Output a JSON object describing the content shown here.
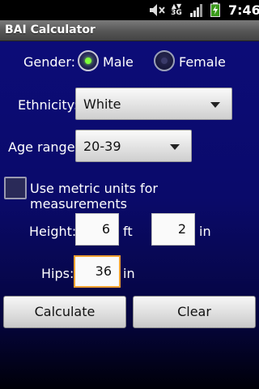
{
  "status_bar": {
    "time": "7:46",
    "network_label": "3G",
    "icons": [
      "mute-icon",
      "3g-icon",
      "signal-icon",
      "battery-charging-icon"
    ]
  },
  "app": {
    "title": "BAI Calculator"
  },
  "form": {
    "gender": {
      "label": "Gender:",
      "options": [
        {
          "label": "Male",
          "selected": true
        },
        {
          "label": "Female",
          "selected": false
        }
      ]
    },
    "ethnicity": {
      "label": "Ethnicity:",
      "value": "White"
    },
    "age_range": {
      "label": "Age range:",
      "value": "20-39"
    },
    "metric": {
      "label": "Use metric units for measurements",
      "checked": false
    },
    "height": {
      "label": "Height:",
      "feet": "6",
      "feet_unit": "ft",
      "inches": "2",
      "inches_unit": "in"
    },
    "hips": {
      "label": "Hips:",
      "value": "36",
      "unit": "in"
    }
  },
  "buttons": {
    "calculate": "Calculate",
    "clear": "Clear"
  },
  "colors": {
    "background_top": "#0c0c78",
    "radio_selected": "#7fff3a",
    "focus_border": "#f0a030"
  }
}
